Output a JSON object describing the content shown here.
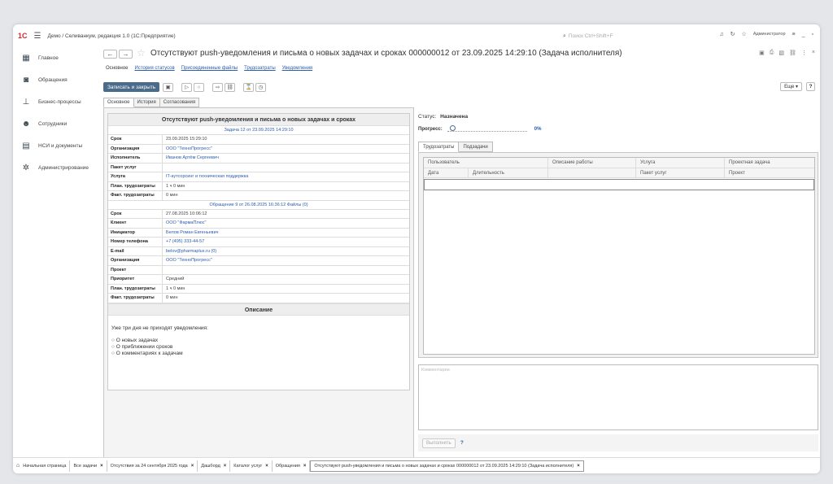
{
  "titlebar": {
    "logo": "1С",
    "app_title": "Демо / Селиванкум, редакция 1.0  (1С:Предприятие)",
    "search_placeholder": "Поиск Ctrl+Shift+F",
    "user": "Администратор"
  },
  "sidebar": {
    "items": [
      {
        "label": "Главное",
        "icon": "grid-icon"
      },
      {
        "label": "Обращения",
        "icon": "chat-icon"
      },
      {
        "label": "Бизнес-процессы",
        "icon": "hierarchy-icon"
      },
      {
        "label": "Сотрудники",
        "icon": "people-icon"
      },
      {
        "label": "НСИ и документы",
        "icon": "document-icon"
      },
      {
        "label": "Администрирование",
        "icon": "gear-icon"
      }
    ]
  },
  "document": {
    "title": "Отсутствуют push-уведомления и письма о новых задачах и сроках 000000012 от 23.09.2025 14:29:10 (Задача исполнителя)",
    "tabs": [
      "Основное",
      "История статусов",
      "Присоединенные файлы",
      "Трудозатраты",
      "Уведомления"
    ],
    "save_close": "Записать и закрыть",
    "more": "Еще",
    "help": "?"
  },
  "subtabs": [
    "Основное",
    "История",
    "Согласования"
  ],
  "info": {
    "title": "Отсутствуют push-уведомления и письма о новых задачах и сроках",
    "task_header": "Задача 12 от 23.09.2025 14:29:10",
    "task_rows": [
      {
        "k": "Срок",
        "v": "23.09.2025 15:29:10",
        "link": false
      },
      {
        "k": "Организация",
        "v": "ООО \"ТехноПрогресс\"",
        "link": true
      },
      {
        "k": "Исполнитель",
        "v": "Иванов Артём Сергеевич",
        "link": true
      },
      {
        "k": "Пакет услуг",
        "v": "",
        "link": false
      },
      {
        "k": "Услуга",
        "v": "IT-аутсорсинг и техническая поддержка",
        "link": true
      },
      {
        "k": "План. трудозатраты",
        "v": "1 ч 0 мин",
        "link": false
      },
      {
        "k": "Факт. трудозатраты",
        "v": "0 мин",
        "link": false
      }
    ],
    "request_header": "Обращение 9 от 26.08.2025 16:36:12   Файлы (0)",
    "request_rows": [
      {
        "k": "Срок",
        "v": "27.08.2025 10:06:12",
        "link": false
      },
      {
        "k": "Клиент",
        "v": "ООО \"ФармаПлюс\"",
        "link": true
      },
      {
        "k": "Инициатор",
        "v": "Белов Роман Евгеньевич",
        "link": true
      },
      {
        "k": "Номер телефона",
        "v": "+7 (495) 333-44-57",
        "link": true
      },
      {
        "k": "E-mail",
        "v": "belov@pharmaplus.ru (0)",
        "link": true
      },
      {
        "k": "Организация",
        "v": "ООО \"ТехноПрогресс\"",
        "link": true
      },
      {
        "k": "Проект",
        "v": "",
        "link": false
      },
      {
        "k": "Приоритет",
        "v": "Средний",
        "link": false
      },
      {
        "k": "План. трудозатраты",
        "v": "1 ч 0 мин",
        "link": false
      },
      {
        "k": "Факт. трудозатраты",
        "v": "0 мин",
        "link": false
      }
    ],
    "description_title": "Описание",
    "description_intro": "Уже три дня не приходят уведомления:",
    "description_items": [
      "О новых задачах",
      "О приближении сроков",
      "О комментариях к задачам"
    ]
  },
  "right": {
    "status_label": "Статус:",
    "status_value": "Назначена",
    "progress_label": "Прогресс:",
    "progress_value": "0%",
    "progress_fraction": 0,
    "tabs": [
      "Трудозатраты",
      "Подзадачи"
    ],
    "grid_headers_row1": [
      "Пользователь",
      "Описание работы",
      "Услуга",
      "Проектная задача"
    ],
    "grid_headers_row2": [
      "Дата",
      "Длительность",
      "",
      "Пакет услуг",
      "Проект"
    ],
    "comment_placeholder": "Комментарии",
    "execute_button": "Выполнить",
    "execute_help": "?"
  },
  "bottom_tabs": [
    "Начальная страница",
    "Все задачи",
    "Отсутствия за 24 сентября 2025 года",
    "Дашборд",
    "Каталог услуг",
    "Обращения",
    "Отсутствуют push-уведомления и письма о новых задачах и сроках 000000012 от 23.09.2025 14:29:10 (Задача исполнителя)"
  ]
}
